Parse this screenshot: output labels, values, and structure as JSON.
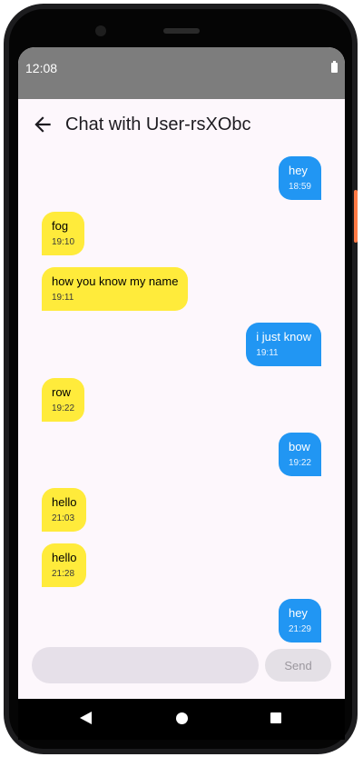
{
  "status": {
    "time": "12:08"
  },
  "app_bar": {
    "title": "Chat with User-rsXObc"
  },
  "messages": [
    {
      "dir": "out",
      "text": "hey",
      "time": "18:59"
    },
    {
      "dir": "in",
      "text": "fog",
      "time": "19:10"
    },
    {
      "dir": "in",
      "text": "how you know my name",
      "time": "19:11"
    },
    {
      "dir": "out",
      "text": "i just know",
      "time": "19:11"
    },
    {
      "dir": "in",
      "text": "row",
      "time": "19:22"
    },
    {
      "dir": "out",
      "text": "bow",
      "time": "19:22"
    },
    {
      "dir": "in",
      "text": "hello",
      "time": "21:03"
    },
    {
      "dir": "in",
      "text": "hello",
      "time": "21:28"
    },
    {
      "dir": "out",
      "text": "hey",
      "time": "21:29"
    }
  ],
  "composer": {
    "placeholder": "",
    "send_label": "Send"
  },
  "colors": {
    "outgoing": "#2196f3",
    "incoming": "#ffeb3b",
    "background": "#fdf7fc"
  },
  "icons": {
    "back": "arrow-left-icon",
    "battery": "battery-icon",
    "nav_back": "triangle-back-icon",
    "nav_home": "circle-home-icon",
    "nav_recents": "square-recents-icon"
  }
}
